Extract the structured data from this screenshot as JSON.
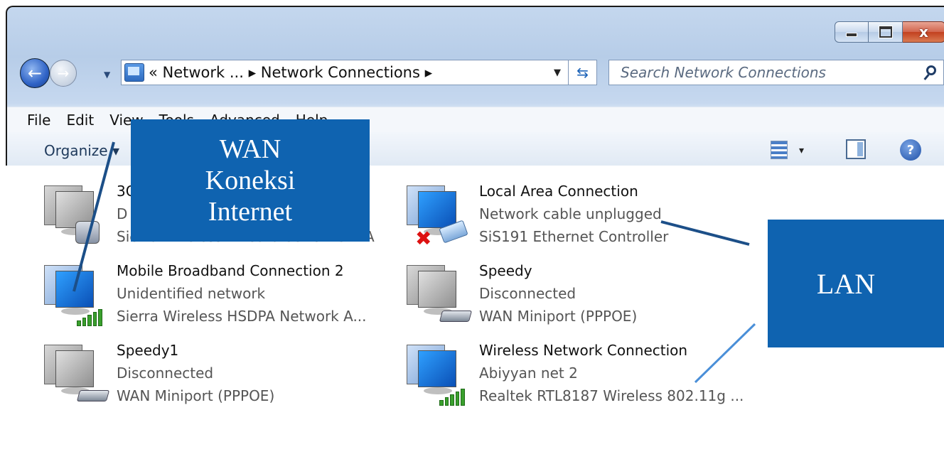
{
  "window": {
    "caption_buttons": {
      "minimize": "–",
      "maximize": "□",
      "close": "x"
    }
  },
  "address_bar": {
    "path": "« Network ... ▸ Network Connections ▸",
    "search_placeholder": "Search Network Connections"
  },
  "menu": [
    "File",
    "Edit",
    "View",
    "Tools",
    "Advanced",
    "Help"
  ],
  "command_bar": {
    "organize": "Organize ▾",
    "view_dropdown": "▾",
    "help": "?"
  },
  "connections": [
    {
      "name": "3G",
      "status": "D",
      "device": "Sierra Wireless AirCard 881U HSDPA",
      "icon": "phone-modem",
      "state": "gray"
    },
    {
      "name": "Local Area Connection",
      "status": "Network cable unplugged",
      "device": "SiS191 Ethernet Controller",
      "icon": "ethernet-disconnected",
      "state": "blue"
    },
    {
      "name": "Mobile Broadband Connection 2",
      "status": "Unidentified network",
      "device": "Sierra Wireless HSDPA Network A...",
      "icon": "signal-bars",
      "state": "blue"
    },
    {
      "name": "Speedy",
      "status": "Disconnected",
      "device": "WAN Miniport (PPPOE)",
      "icon": "modem",
      "state": "gray"
    },
    {
      "name": "Speedy1",
      "status": "Disconnected",
      "device": "WAN Miniport (PPPOE)",
      "icon": "modem",
      "state": "gray"
    },
    {
      "name": "Wireless Network Connection",
      "status": "Abiyyan net  2",
      "device": "Realtek RTL8187 Wireless 802.11g ...",
      "icon": "signal-bars",
      "state": "blue"
    }
  ],
  "annotations": {
    "wan": "WAN Koneksi Internet",
    "wan_lines": [
      "WAN",
      "Koneksi",
      "Internet"
    ],
    "lan": "LAN",
    "color": "#0f63b0"
  }
}
